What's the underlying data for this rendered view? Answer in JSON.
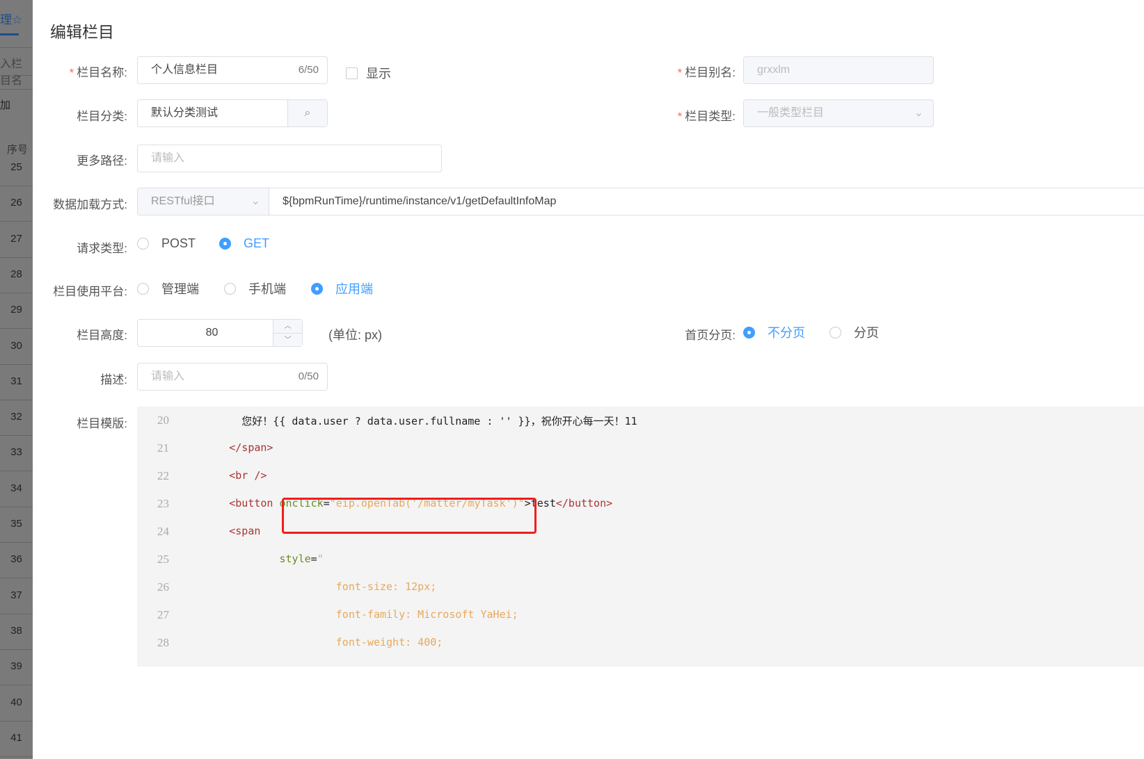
{
  "background": {
    "tab_label": "理",
    "search_placeholder": "入栏目名",
    "add_label": "加",
    "col_index": "序号",
    "row_numbers": [
      "25",
      "26",
      "27",
      "28",
      "29",
      "30",
      "31",
      "32",
      "33",
      "34",
      "35",
      "36",
      "37",
      "38",
      "39",
      "40",
      "41"
    ]
  },
  "dialog": {
    "title": "编辑栏目",
    "name": {
      "label": "栏目名称:",
      "value": "个人信息栏目",
      "count": "6/50"
    },
    "show": {
      "label": "显示"
    },
    "alias": {
      "label": "栏目别名:",
      "value": "grxxlm"
    },
    "category": {
      "label": "栏目分类:",
      "value": "默认分类测试"
    },
    "type": {
      "label": "栏目类型:",
      "value": "一般类型栏目"
    },
    "more_path": {
      "label": "更多路径:",
      "placeholder": "请输入"
    },
    "load": {
      "label": "数据加载方式:",
      "method": "RESTful接口",
      "url": "${bpmRunTime}/runtime/instance/v1/getDefaultInfoMap"
    },
    "request": {
      "label": "请求类型:",
      "options": [
        "POST",
        "GET"
      ],
      "selected": "GET"
    },
    "platform": {
      "label": "栏目使用平台:",
      "options": [
        "管理端",
        "手机端",
        "应用端"
      ],
      "selected": "应用端"
    },
    "height": {
      "label": "栏目高度:",
      "value": "80",
      "unit": "(单位: px)"
    },
    "paging": {
      "label": "首页分页:",
      "options": [
        "不分页",
        "分页"
      ],
      "selected": "不分页"
    },
    "desc": {
      "label": "描述:",
      "placeholder": "请输入",
      "count": "0/50"
    },
    "template": {
      "label": "栏目模版:",
      "lines": [
        {
          "no": "20",
          "parts": [
            {
              "c": "txt",
              "t": "          您好！{{ data.user ? data.user.fullname : '' }}，祝你开心每一天！11"
            }
          ]
        },
        {
          "no": "21",
          "parts": [
            {
              "c": "tag",
              "t": "        </span>"
            }
          ]
        },
        {
          "no": "22",
          "parts": [
            {
              "c": "tag",
              "t": "        <br />"
            }
          ]
        },
        {
          "no": "23",
          "parts": [
            {
              "c": "tag",
              "t": "        <button "
            },
            {
              "c": "attr",
              "t": "onclick"
            },
            {
              "c": "txt",
              "t": "="
            },
            {
              "c": "str",
              "t": "\"eip.openTab('/matter/myTask')\""
            },
            {
              "c": "txt",
              "t": ">test"
            },
            {
              "c": "tag",
              "t": "</button>"
            }
          ]
        },
        {
          "no": "24",
          "parts": [
            {
              "c": "tag",
              "t": "        <span"
            }
          ]
        },
        {
          "no": "25",
          "parts": [
            {
              "c": "attr",
              "t": "                style"
            },
            {
              "c": "txt",
              "t": "="
            },
            {
              "c": "str",
              "t": "\""
            }
          ]
        },
        {
          "no": "26",
          "parts": [
            {
              "c": "str",
              "t": "                         font-size: 12px;"
            }
          ]
        },
        {
          "no": "27",
          "parts": [
            {
              "c": "str",
              "t": "                         font-family: Microsoft YaHei;"
            }
          ]
        },
        {
          "no": "28",
          "parts": [
            {
              "c": "str",
              "t": "                         font-weight: 400;"
            }
          ]
        }
      ]
    }
  }
}
